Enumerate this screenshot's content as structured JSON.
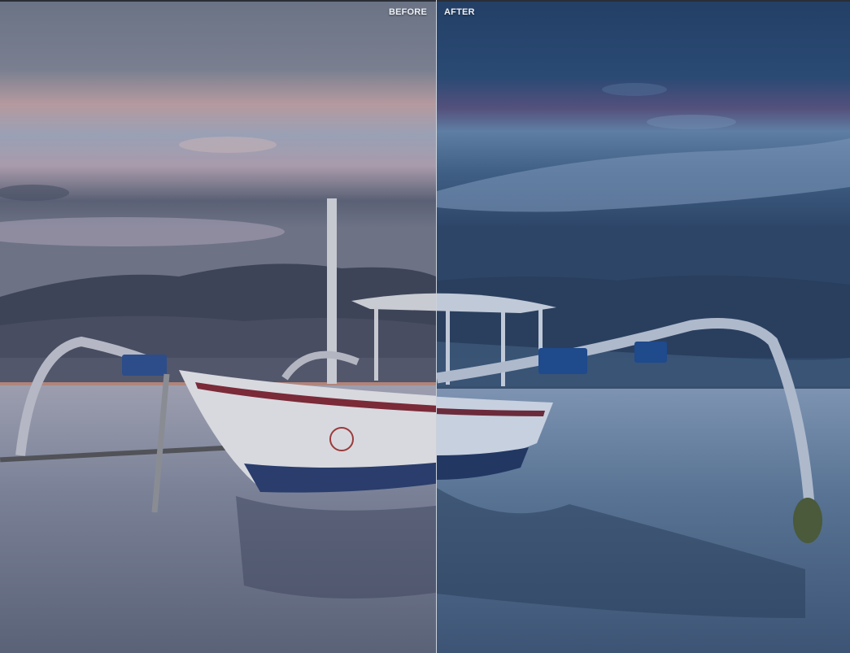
{
  "comparison": {
    "before_label": "BEFORE",
    "after_label": "AFTER",
    "split_position_fraction": 0.513
  },
  "colors": {
    "divider": "#ebf0f8",
    "label_text": "#eef1f6"
  }
}
